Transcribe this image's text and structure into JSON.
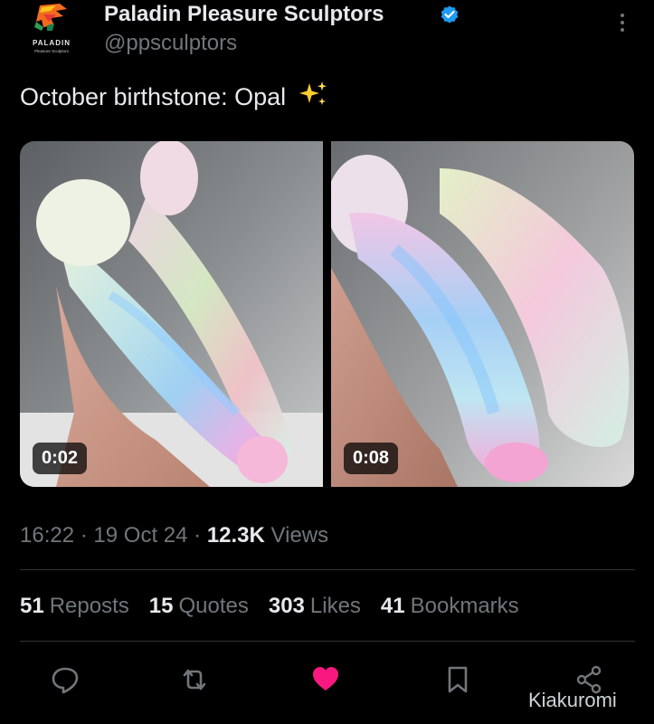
{
  "author": {
    "logo_text": "PALADIN",
    "logo_subtext": "Pleasure Sculptors",
    "display_name": "Paladin Pleasure Sculptors",
    "handle": "@ppsculptors",
    "verified_color": "#1d9bf0"
  },
  "post": {
    "text": "October birthstone: Opal",
    "emoji": "sparkles-icon"
  },
  "media": [
    {
      "duration": "0:02"
    },
    {
      "duration": "0:08"
    }
  ],
  "meta": {
    "time": "16:22",
    "date": "19 Oct 24",
    "views_count": "12.3K",
    "views_label": "Views",
    "separator": "·"
  },
  "stats": {
    "reposts_count": "51",
    "reposts_label": "Reposts",
    "quotes_count": "15",
    "quotes_label": "Quotes",
    "likes_count": "303",
    "likes_label": "Likes",
    "bookmarks_count": "41",
    "bookmarks_label": "Bookmarks"
  },
  "actions": [
    "reply-icon",
    "repost-icon",
    "like-icon",
    "bookmark-icon",
    "share-icon"
  ],
  "colors": {
    "like": "#f91880",
    "muted": "#71767b",
    "text": "#e7e9ea"
  },
  "watermark": "Kiakuromi"
}
